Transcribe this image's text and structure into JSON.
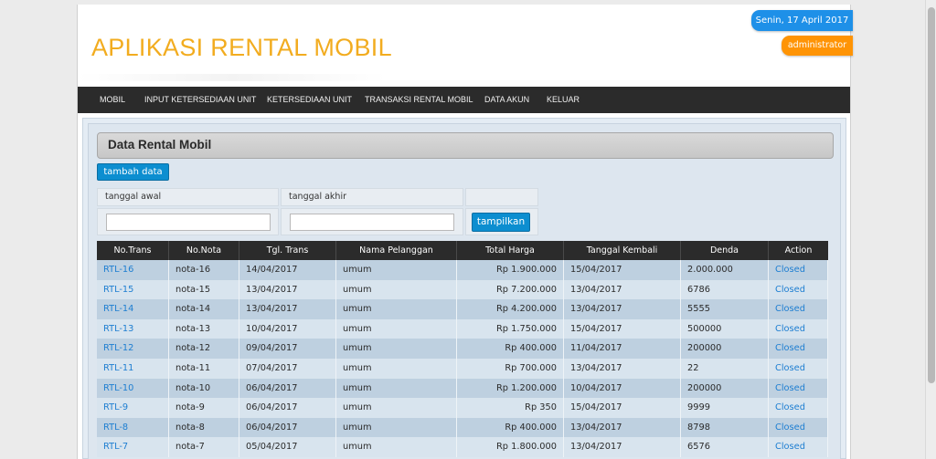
{
  "header": {
    "title": "APLIKASI RENTAL MOBIL",
    "date": "Senin, 17 April 2017",
    "user": "administrator"
  },
  "nav": {
    "items": [
      {
        "label": "MOBIL"
      },
      {
        "label": "INPUT KETERSEDIAAN UNIT"
      },
      {
        "label": "KETERSEDIAAN UNIT"
      },
      {
        "label": "TRANSAKSI RENTAL MOBIL"
      },
      {
        "label": "DATA AKUN"
      },
      {
        "label": "KELUAR"
      }
    ]
  },
  "section": {
    "title": "Data Rental Mobil",
    "add_button": "tambah data"
  },
  "filter": {
    "start_label": "tanggal awal",
    "end_label": "tanggal akhir",
    "start_value": "",
    "end_value": "",
    "submit": "tampilkan"
  },
  "table": {
    "columns": [
      "No.Trans",
      "No.Nota",
      "Tgl. Trans",
      "Nama Pelanggan",
      "Total Harga",
      "Tanggal Kembali",
      "Denda",
      "Action"
    ],
    "rows": [
      {
        "no_trans": "RTL-16",
        "no_nota": "nota-16",
        "tgl_trans": "14/04/2017",
        "pelanggan": "umum",
        "total": "Rp 1.900.000",
        "kembali": "15/04/2017",
        "denda": "2.000.000",
        "action": "Closed"
      },
      {
        "no_trans": "RTL-15",
        "no_nota": "nota-15",
        "tgl_trans": "13/04/2017",
        "pelanggan": "umum",
        "total": "Rp 7.200.000",
        "kembali": "13/04/2017",
        "denda": "6786",
        "action": "Closed"
      },
      {
        "no_trans": "RTL-14",
        "no_nota": "nota-14",
        "tgl_trans": "13/04/2017",
        "pelanggan": "umum",
        "total": "Rp 4.200.000",
        "kembali": "13/04/2017",
        "denda": "5555",
        "action": "Closed"
      },
      {
        "no_trans": "RTL-13",
        "no_nota": "nota-13",
        "tgl_trans": "10/04/2017",
        "pelanggan": "umum",
        "total": "Rp 1.750.000",
        "kembali": "15/04/2017",
        "denda": "500000",
        "action": "Closed"
      },
      {
        "no_trans": "RTL-12",
        "no_nota": "nota-12",
        "tgl_trans": "09/04/2017",
        "pelanggan": "umum",
        "total": "Rp 400.000",
        "kembali": "11/04/2017",
        "denda": "200000",
        "action": "Closed"
      },
      {
        "no_trans": "RTL-11",
        "no_nota": "nota-11",
        "tgl_trans": "07/04/2017",
        "pelanggan": "umum",
        "total": "Rp 700.000",
        "kembali": "13/04/2017",
        "denda": "22",
        "action": "Closed"
      },
      {
        "no_trans": "RTL-10",
        "no_nota": "nota-10",
        "tgl_trans": "06/04/2017",
        "pelanggan": "umum",
        "total": "Rp 1.200.000",
        "kembali": "10/04/2017",
        "denda": "200000",
        "action": "Closed"
      },
      {
        "no_trans": "RTL-9",
        "no_nota": "nota-9",
        "tgl_trans": "06/04/2017",
        "pelanggan": "umum",
        "total": "Rp 350",
        "kembali": "15/04/2017",
        "denda": "9999",
        "action": "Closed"
      },
      {
        "no_trans": "RTL-8",
        "no_nota": "nota-8",
        "tgl_trans": "06/04/2017",
        "pelanggan": "umum",
        "total": "Rp 400.000",
        "kembali": "13/04/2017",
        "denda": "8798",
        "action": "Closed"
      },
      {
        "no_trans": "RTL-7",
        "no_nota": "nota-7",
        "tgl_trans": "05/04/2017",
        "pelanggan": "umum",
        "total": "Rp 1.800.000",
        "kembali": "13/04/2017",
        "denda": "6576",
        "action": "Closed"
      }
    ]
  },
  "colors": {
    "title": "#f2ac1f",
    "date_badge": "#1e90e8",
    "user_badge": "#ff9405",
    "nav_bg": "#2b2b2b",
    "link": "#1e7ed1",
    "button": "#0c8ed0"
  }
}
